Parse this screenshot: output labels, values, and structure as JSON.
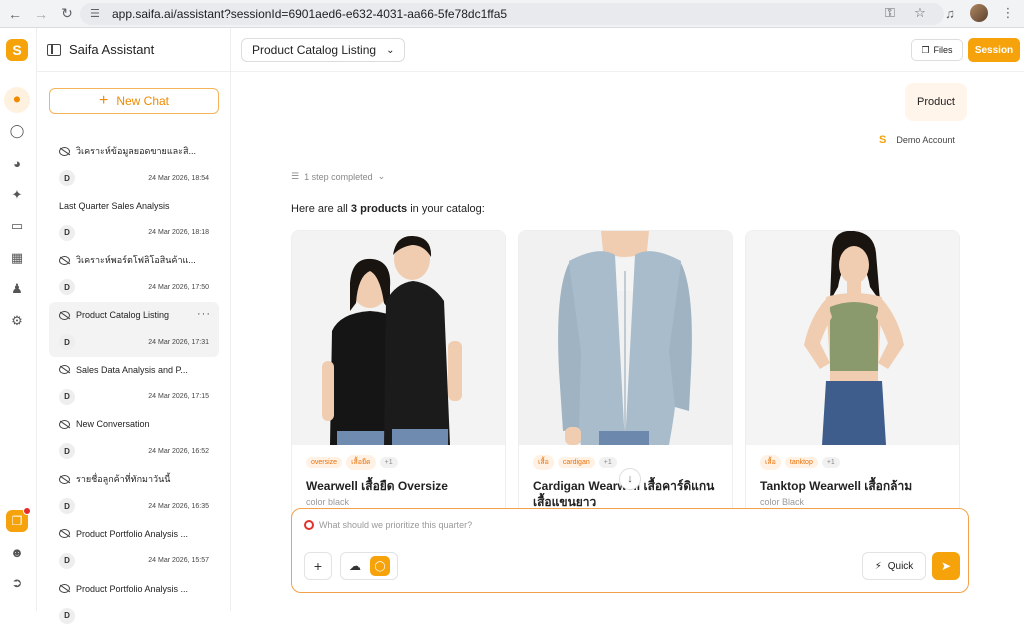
{
  "browser": {
    "url": "app.saifa.ai/assistant?sessionId=6901aed6-e632-4031-aa66-5fe78dc1ffa5",
    "back_icon": "arrow-left-icon",
    "forward_icon": "arrow-right-icon",
    "reload_icon": "reload-icon"
  },
  "rail": {
    "icons": [
      "home-icon",
      "chat-icon",
      "pie-chart-icon",
      "sparkle-icon",
      "folder-icon",
      "store-icon",
      "team-icon",
      "settings-icon",
      "copy-icon",
      "user-icon",
      "logout-icon"
    ]
  },
  "sidebar": {
    "title": "Saifa Assistant",
    "new_chat": "New Chat",
    "chats": [
      {
        "title": "วิเคราะห์ข้อมูลยอดขายและสิ...",
        "avatar": "D",
        "date": "24 Mar 2026, 18:54"
      },
      {
        "title": "Last Quarter Sales Analysis",
        "avatar": "D",
        "date": "24 Mar 2026, 18:18"
      },
      {
        "title": "วิเคราะห์พอร์ตโฟลิโอสินค้าแ...",
        "avatar": "D",
        "date": "24 Mar 2026, 17:50"
      },
      {
        "title": "Product Catalog Listing",
        "avatar": "D",
        "date": "24 Mar 2026, 17:31"
      },
      {
        "title": "Sales Data Analysis and P...",
        "avatar": "D",
        "date": "24 Mar 2026, 17:15"
      },
      {
        "title": "New Conversation",
        "avatar": "D",
        "date": "24 Mar 2026, 16:52"
      },
      {
        "title": "รายชื่อลูกค้าที่ทักมาวันนี้",
        "avatar": "D",
        "date": "24 Mar 2026, 16:35"
      },
      {
        "title": "Product Portfolio Analysis ...",
        "avatar": "D",
        "date": "24 Mar 2026, 15:57"
      },
      {
        "title": "Product Portfolio Analysis ...",
        "avatar": "D",
        "date": ""
      }
    ]
  },
  "header": {
    "conversation_title": "Product Catalog Listing",
    "files_label": "Files",
    "session_label": "Session"
  },
  "conversation": {
    "user_message": "Product",
    "account_name": "Demo Account",
    "steps_label": "1 step completed",
    "intro_prefix": "Here are all ",
    "intro_bold": "3 products",
    "intro_suffix": " in your catalog:",
    "products": [
      {
        "tags": [
          "oversize",
          "เสื้อยืด",
          "+1"
        ],
        "name": "Wearwell เสื้อยืด Oversize",
        "color": "color black"
      },
      {
        "tags": [
          "เสื้อ",
          "cardigan",
          "+1"
        ],
        "name": "Cardigan Wearwell เสื้อคาร์ดิแกน เสื้อแขนยาว",
        "color": ""
      },
      {
        "tags": [
          "เสื้อ",
          "tanktop",
          "+1"
        ],
        "name": "Tanktop Wearwell เสื้อกล้าม",
        "color": "color Black"
      }
    ]
  },
  "composer": {
    "placeholder": "What should we prioritize this quarter?",
    "quick_label": "Quick"
  }
}
